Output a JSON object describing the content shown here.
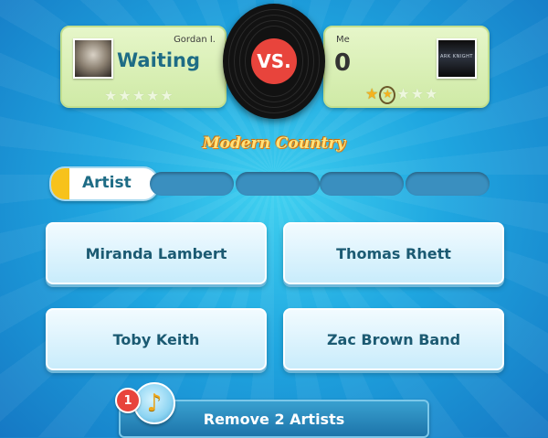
{
  "opponent": {
    "name": "Gordan I.",
    "status": "Waiting",
    "stars": [
      false,
      false,
      false,
      false,
      false
    ]
  },
  "me": {
    "name": "Me",
    "score": "0",
    "avatar_caption": "ARK KNIGHT",
    "stars": [
      "filled",
      "current",
      "empty",
      "empty",
      "empty"
    ]
  },
  "versus_label": "VS.",
  "category": "Modern Country",
  "question": {
    "type_label": "Artist",
    "progress": {
      "current": 1,
      "total": 5
    }
  },
  "answers": [
    "Miranda Lambert",
    "Thomas Rhett",
    "Toby Keith",
    "Zac Brown Band"
  ],
  "powerup": {
    "count": "1",
    "label": "Remove 2 Artists",
    "icon": "music-note-icon"
  },
  "colors": {
    "accent_yellow": "#f7c21b",
    "vs_red": "#e8443c",
    "text_teal": "#1e6c85"
  }
}
